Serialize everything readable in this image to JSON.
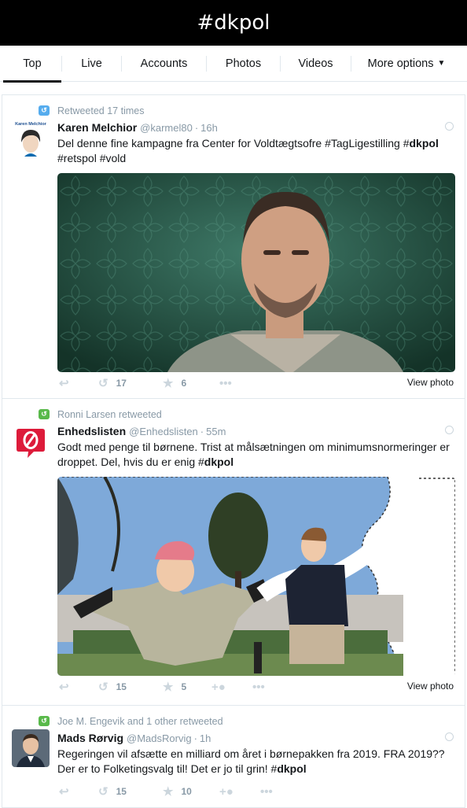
{
  "header": {
    "title": "#dkpol"
  },
  "tabs": [
    {
      "label": "Top"
    },
    {
      "label": "Live"
    },
    {
      "label": "Accounts"
    },
    {
      "label": "Photos"
    },
    {
      "label": "Videos"
    },
    {
      "label": "More options"
    }
  ],
  "tweets": [
    {
      "context": "Retweeted 17 times",
      "avatar_caption": "Karen Melchior",
      "fullname": "Karen Melchior",
      "handle": "@karmel80",
      "time": "16h",
      "text_parts": [
        "Del denne fine kampagne fra Center for Voldtægtsofre #TagLigestilling #",
        "dkpol",
        " #retspol #vold"
      ],
      "view_photo": "View photo",
      "retweets": "17",
      "likes": "6"
    },
    {
      "context": "Ronni Larsen retweeted",
      "fullname": "Enhedslisten",
      "handle": "@Enhedslisten",
      "time": "55m",
      "text_parts": [
        "Godt med penge til børnene. Trist at målsætningen om minimumsnormeringer er droppet. Del, hvis du er enig #",
        "dkpol"
      ],
      "view_photo": "View photo",
      "retweets": "15",
      "likes": "5"
    },
    {
      "context": "Joe M. Engevik and 1 other retweeted",
      "fullname": "Mads Rørvig",
      "handle": "@MadsRorvig",
      "time": "1h",
      "text_parts": [
        "Regeringen vil afsætte en milliard om året i børnepakken fra 2019. FRA 2019?? Der er to Folketingsvalg til! Det er jo til grin! #",
        "dkpol"
      ],
      "retweets": "15",
      "likes": "10"
    }
  ],
  "icons": {
    "reply": "reply-icon",
    "retweet": "retweet-icon",
    "like": "star-icon",
    "more": "more-icon",
    "follow": "follow-icon"
  }
}
